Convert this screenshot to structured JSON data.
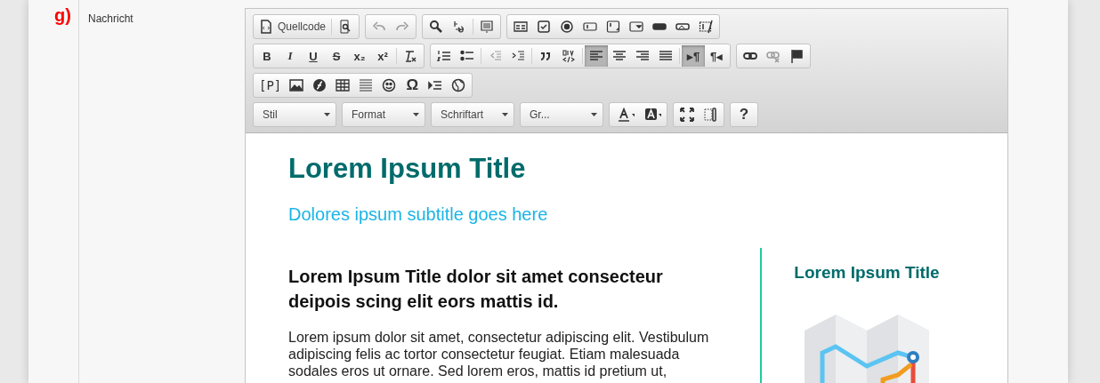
{
  "field": {
    "marker": "g)",
    "label": "Nachricht"
  },
  "toolbar": {
    "rows": [
      {
        "groups": [
          {
            "parts": [
              [
                {
                  "kind": "icon-label",
                  "label": "Quellcode",
                  "disabled": false,
                  "selected": false
                }
              ],
              [
                {
                  "kind": "icon",
                  "disabled": false,
                  "selected": false
                }
              ]
            ]
          },
          {
            "parts": [
              [
                {
                  "kind": "icon",
                  "disabled": true,
                  "selected": false
                },
                {
                  "kind": "icon",
                  "disabled": true,
                  "selected": false
                }
              ]
            ]
          },
          {
            "parts": [
              [
                {
                  "kind": "icon",
                  "disabled": false,
                  "selected": false
                },
                {
                  "kind": "icon",
                  "disabled": false,
                  "selected": false
                }
              ],
              [
                {
                  "kind": "icon",
                  "disabled": false,
                  "selected": false
                }
              ]
            ]
          },
          {
            "parts": [
              [
                {
                  "kind": "icon",
                  "disabled": false,
                  "selected": false
                },
                {
                  "kind": "icon",
                  "disabled": false,
                  "selected": false
                },
                {
                  "kind": "icon",
                  "disabled": false,
                  "selected": false
                },
                {
                  "kind": "icon",
                  "disabled": false,
                  "selected": false
                },
                {
                  "kind": "icon",
                  "disabled": false,
                  "selected": false
                },
                {
                  "kind": "icon",
                  "disabled": false,
                  "selected": false
                },
                {
                  "kind": "icon",
                  "disabled": false,
                  "selected": false
                },
                {
                  "kind": "icon",
                  "disabled": false,
                  "selected": false
                },
                {
                  "kind": "icon",
                  "disabled": false,
                  "selected": false
                }
              ]
            ]
          }
        ]
      },
      {
        "groups": [
          {
            "parts": [
              [
                {
                  "kind": "label",
                  "label": "B",
                  "disabled": false,
                  "selected": false
                },
                {
                  "kind": "label",
                  "label": "I",
                  "disabled": false,
                  "selected": false
                },
                {
                  "kind": "label",
                  "label": "U",
                  "disabled": false,
                  "selected": false
                },
                {
                  "kind": "label",
                  "label": "S",
                  "disabled": false,
                  "selected": false
                },
                {
                  "kind": "label",
                  "label": "x₂",
                  "disabled": false,
                  "selected": false
                },
                {
                  "kind": "label",
                  "label": "x²",
                  "disabled": false,
                  "selected": false
                }
              ],
              [
                {
                  "kind": "icon",
                  "disabled": false,
                  "selected": false
                }
              ]
            ]
          },
          {
            "parts": [
              [
                {
                  "kind": "icon",
                  "disabled": false,
                  "selected": false
                },
                {
                  "kind": "icon",
                  "disabled": false,
                  "selected": false
                }
              ],
              [
                {
                  "kind": "icon",
                  "disabled": true,
                  "selected": false
                },
                {
                  "kind": "icon",
                  "disabled": false,
                  "selected": false
                }
              ],
              [
                {
                  "kind": "icon",
                  "disabled": false,
                  "selected": false
                },
                {
                  "kind": "icon",
                  "disabled": false,
                  "selected": false
                }
              ],
              [
                {
                  "kind": "icon",
                  "disabled": false,
                  "selected": true
                },
                {
                  "kind": "icon",
                  "disabled": false,
                  "selected": false
                },
                {
                  "kind": "icon",
                  "disabled": false,
                  "selected": false
                },
                {
                  "kind": "icon",
                  "disabled": false,
                  "selected": false
                }
              ],
              [
                {
                  "kind": "label",
                  "label": "▸¶",
                  "disabled": false,
                  "selected": true
                },
                {
                  "kind": "label",
                  "label": "¶◂",
                  "disabled": false,
                  "selected": false
                }
              ]
            ]
          },
          {
            "parts": [
              [
                {
                  "kind": "icon",
                  "disabled": false,
                  "selected": false
                },
                {
                  "kind": "icon",
                  "disabled": true,
                  "selected": false
                },
                {
                  "kind": "icon",
                  "disabled": false,
                  "selected": false
                }
              ]
            ]
          }
        ]
      },
      {
        "groups": [
          {
            "parts": [
              [
                {
                  "kind": "label",
                  "label": "[P]",
                  "disabled": false,
                  "selected": false
                },
                {
                  "kind": "icon",
                  "disabled": false,
                  "selected": false
                },
                {
                  "kind": "icon",
                  "disabled": false,
                  "selected": false
                },
                {
                  "kind": "icon",
                  "disabled": false,
                  "selected": false
                },
                {
                  "kind": "icon",
                  "disabled": false,
                  "selected": false
                },
                {
                  "kind": "icon",
                  "disabled": false,
                  "selected": false
                },
                {
                  "kind": "label",
                  "label": "Ω",
                  "disabled": false,
                  "selected": false
                },
                {
                  "kind": "icon",
                  "disabled": false,
                  "selected": false
                },
                {
                  "kind": "icon",
                  "disabled": false,
                  "selected": false
                }
              ]
            ]
          }
        ]
      }
    ],
    "dropdowns": [
      {
        "label": "Stil"
      },
      {
        "label": "Format"
      },
      {
        "label": "Schriftart"
      },
      {
        "label": "Gr..."
      }
    ],
    "extra_groups": [
      {
        "parts": [
          [
            {
              "kind": "icon",
              "disabled": false,
              "selected": false
            },
            {
              "kind": "icon",
              "disabled": false,
              "selected": false
            }
          ]
        ]
      },
      {
        "parts": [
          [
            {
              "kind": "icon",
              "disabled": false,
              "selected": false
            },
            {
              "kind": "icon",
              "disabled": false,
              "selected": false
            }
          ]
        ]
      },
      {
        "parts": [
          [
            {
              "kind": "label",
              "label": "?",
              "disabled": false,
              "selected": false
            }
          ]
        ]
      }
    ]
  },
  "content": {
    "title": "Lorem Ipsum Title",
    "subtitle": "Dolores ipsum subtitle goes here",
    "main": {
      "heading": "Lorem Ipsum Title dolor sit amet consecteur deipois scing elit eors mattis id.",
      "paragraph": "Lorem ipsum dolor sit amet, consectetur adipiscing elit. Vestibulum adipiscing felis ac tortor consectetur feugiat. Etiam malesuada sodales eros ut ornare. Sed lorem eros, mattis id pretium ut,"
    },
    "aside": {
      "title": "Lorem Ipsum Title"
    }
  }
}
